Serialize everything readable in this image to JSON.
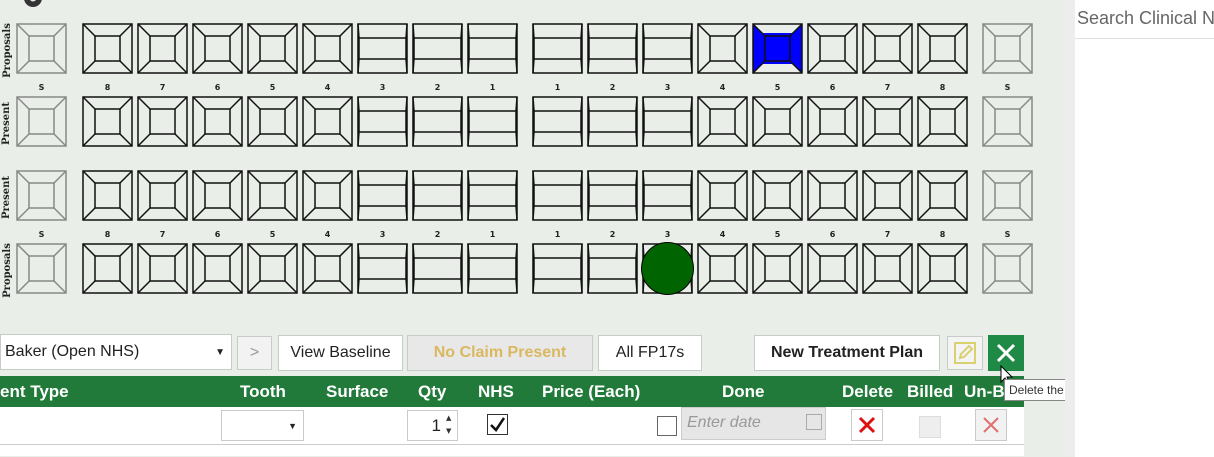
{
  "chart_labels": {
    "upper_proposals": "Proposals",
    "upper_present": "Present",
    "lower_present": "Present",
    "lower_proposals": "Proposals"
  },
  "tooth_numbers": [
    "S",
    "8",
    "7",
    "6",
    "5",
    "4",
    "3",
    "2",
    "1",
    "1",
    "2",
    "3",
    "4",
    "5",
    "6",
    "7",
    "8",
    "S"
  ],
  "toolbar": {
    "patient_select": "Baker (Open NHS)",
    "next_label": ">",
    "view_baseline": "View Baseline",
    "no_claim": "No Claim Present",
    "all_fp17s": "All FP17s",
    "new_plan": "New Treatment Plan",
    "tooltip": "Delete the selected treatment plan"
  },
  "table": {
    "headers": [
      "ent Type",
      "Tooth",
      "Surface",
      "Qty",
      "NHS",
      "Price (Each)",
      "Done",
      "Delete",
      "Billed",
      "Un-B"
    ],
    "row": {
      "qty": "1",
      "date_placeholder": "Enter date"
    }
  },
  "right_panel": {
    "search_placeholder": "Search Clinical N"
  },
  "colors": {
    "green_header": "#217a3a",
    "blue_fill": "#0000ff",
    "green_fill": "#006400"
  }
}
